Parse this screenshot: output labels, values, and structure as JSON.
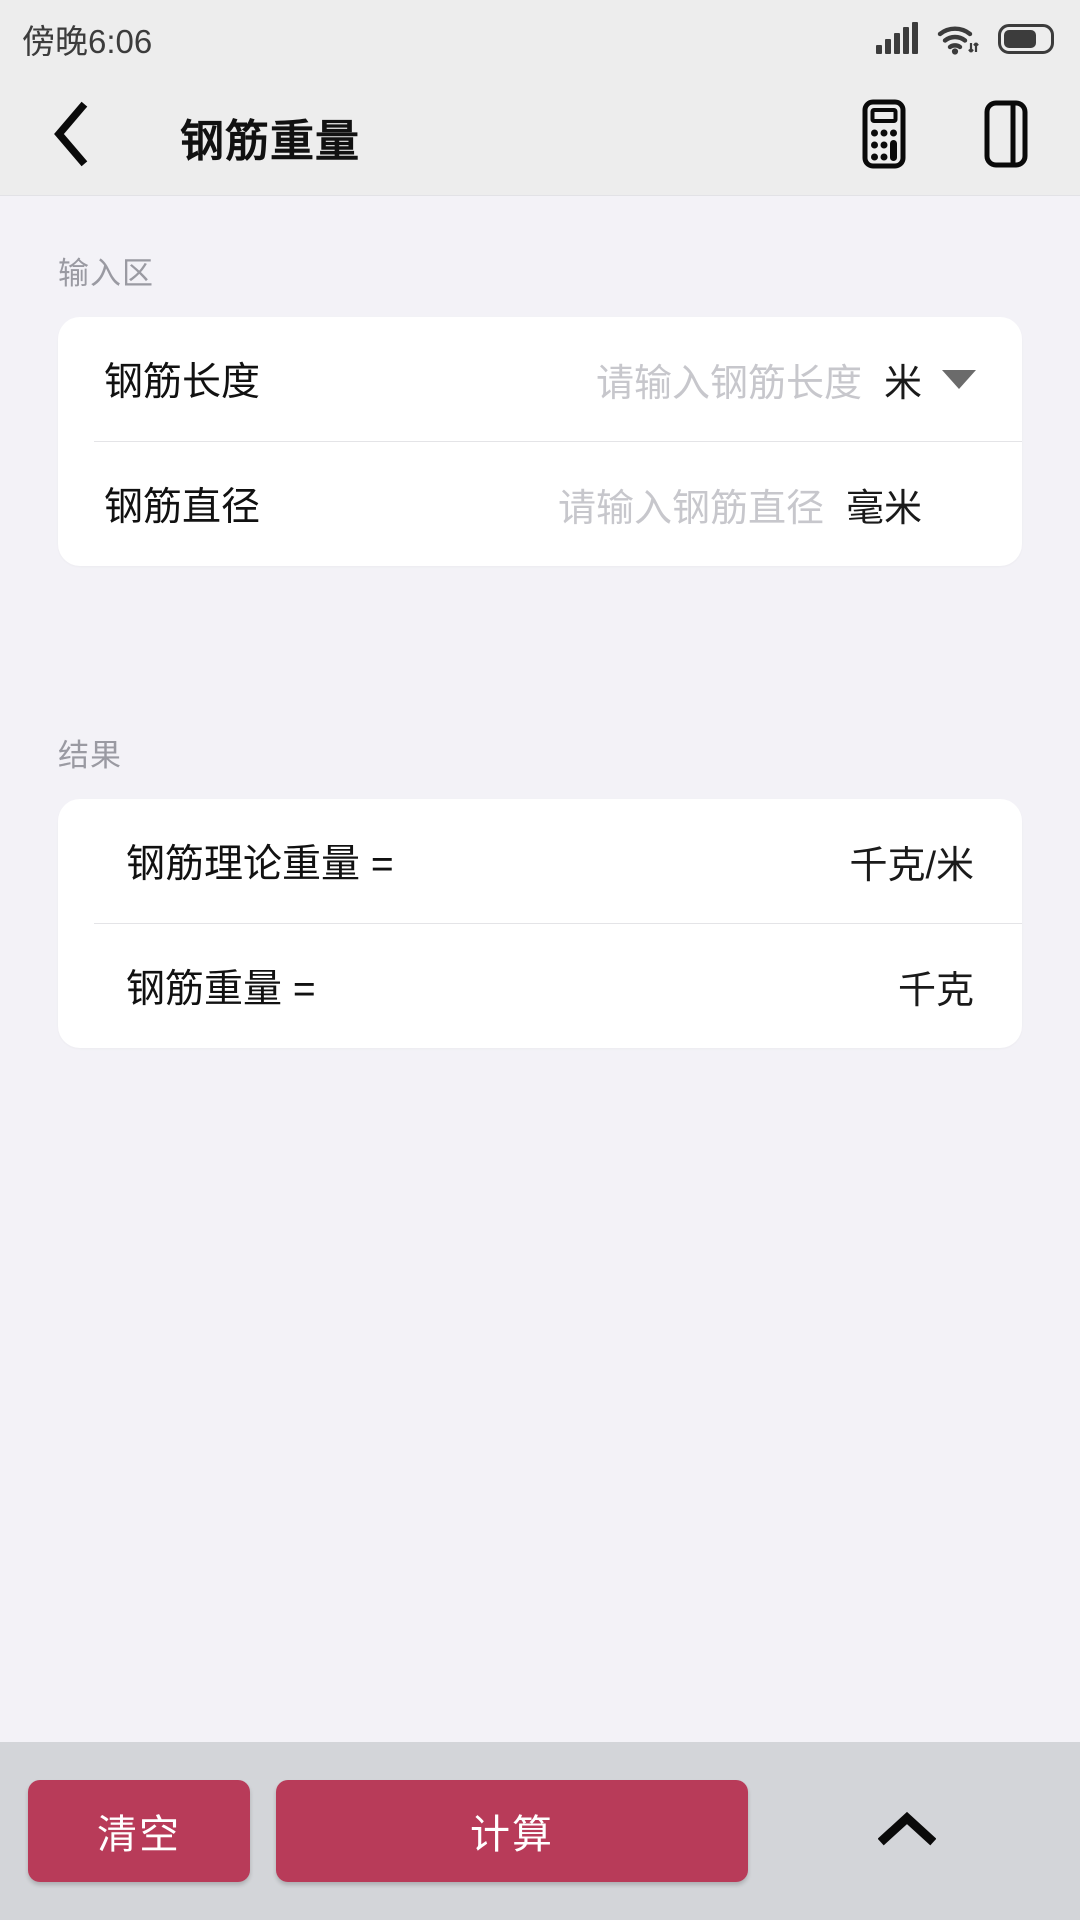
{
  "statusbar": {
    "time": "傍晚6:06",
    "icons": [
      "signal-icon",
      "wifi-icon",
      "battery-icon"
    ]
  },
  "header": {
    "back_icon": "chevron-left-icon",
    "title": "钢筋重量",
    "actions": [
      {
        "icon": "calculator-icon"
      },
      {
        "icon": "panel-layout-icon"
      }
    ]
  },
  "input_section": {
    "label": "输入区",
    "fields": [
      {
        "label": "钢筋长度",
        "value": "",
        "placeholder": "请输入钢筋长度",
        "unit": "米",
        "has_dropdown": true,
        "dropdown_icon": "triangle-down-icon"
      },
      {
        "label": "钢筋直径",
        "value": "",
        "placeholder": "请输入钢筋直径",
        "unit": "毫米",
        "has_dropdown": false
      }
    ]
  },
  "result_section": {
    "label": "结果",
    "rows": [
      {
        "label": "钢筋理论重量 =",
        "value": "",
        "unit": "千克/米"
      },
      {
        "label": "钢筋重量 =",
        "value": "",
        "unit": "千克"
      }
    ]
  },
  "bottombar": {
    "clear_label": "清空",
    "calc_label": "计算",
    "collapse_icon": "chevron-up-icon"
  },
  "colors": {
    "accent": "#B83B59",
    "page_bg": "#F3F2F7",
    "header_bg": "#EDEDED",
    "card_bg": "#FFFFFF",
    "bottombar_bg": "#D3D5D9",
    "muted_text": "#9A9AA2",
    "placeholder_text": "#C7C7CC"
  }
}
